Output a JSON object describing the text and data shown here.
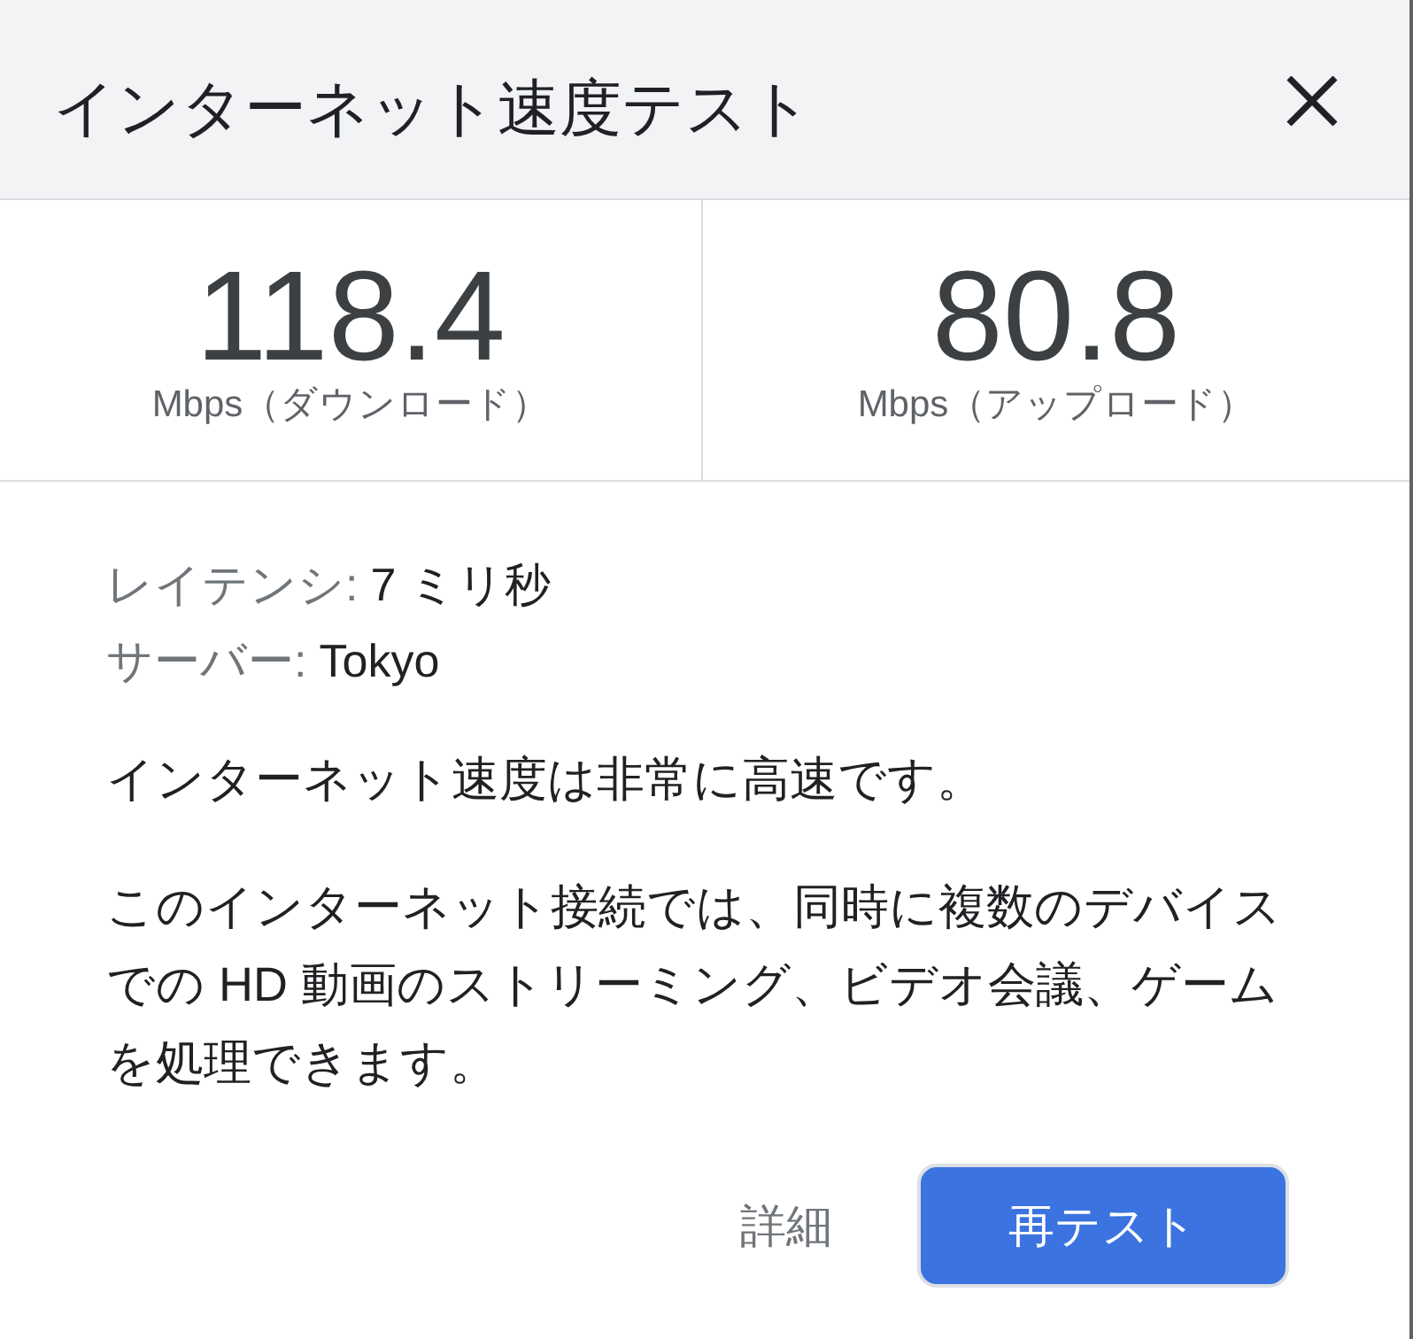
{
  "dialog": {
    "title": "インターネット速度テスト"
  },
  "results": [
    {
      "value": "118.4",
      "unit": "Mbps（ダウンロード）"
    },
    {
      "value": "80.8",
      "unit": "Mbps（アップロード）"
    }
  ],
  "details": [
    {
      "label": "レイテンシ:",
      "value": "7 ミリ秒"
    },
    {
      "label": "サーバー:",
      "value": "Tokyo"
    }
  ],
  "summary": "インターネット速度は非常に高速です。",
  "description": "このインターネット接続では、同時に複数のデバイスでの HD 動画のストリーミング、ビデオ会議、ゲームを処理できます。",
  "buttons": [
    {
      "label": "詳細",
      "kind": "text"
    },
    {
      "label": "再テスト",
      "kind": "primary"
    }
  ]
}
